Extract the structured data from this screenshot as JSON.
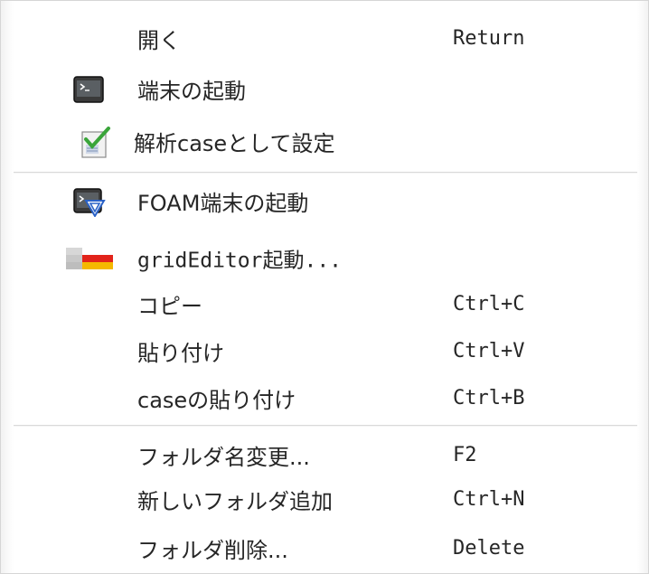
{
  "menu": {
    "items": [
      {
        "label": "開く",
        "shortcut": "Return",
        "icon": null
      },
      {
        "label": "端末の起動",
        "shortcut": "",
        "icon": "terminal-icon"
      },
      {
        "label": "解析caseとして設定",
        "shortcut": "",
        "icon": "checked-clipboard-icon"
      },
      {
        "label": "FOAM端末の起動",
        "shortcut": "",
        "icon": "foam-terminal-icon"
      },
      {
        "label": "gridEditor起動...",
        "shortcut": "",
        "icon": "grid-editor-icon"
      },
      {
        "label": "コピー",
        "shortcut": "Ctrl+C",
        "icon": null
      },
      {
        "label": "貼り付け",
        "shortcut": "Ctrl+V",
        "icon": null
      },
      {
        "label": "caseの貼り付け",
        "shortcut": "Ctrl+B",
        "icon": null
      },
      {
        "label": "フォルダ名変更...",
        "shortcut": "F2",
        "icon": null
      },
      {
        "label": "新しいフォルダ追加",
        "shortcut": "Ctrl+N",
        "icon": null
      },
      {
        "label": "フォルダ削除...",
        "shortcut": "Delete",
        "icon": null
      }
    ]
  },
  "colors": {
    "text": "#262626",
    "separator": "#d9d9d9",
    "background": "#ffffff"
  }
}
